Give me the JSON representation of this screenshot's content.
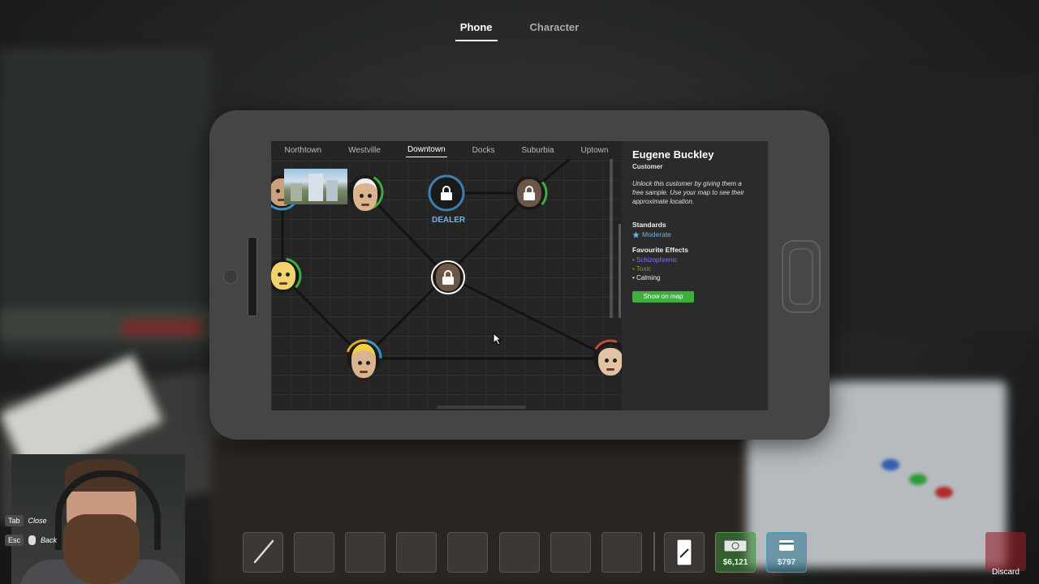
{
  "top_tabs": [
    {
      "label": "Phone",
      "active": true
    },
    {
      "label": "Character",
      "active": false
    }
  ],
  "map": {
    "regions": [
      "Northtown",
      "Westville",
      "Downtown",
      "Docks",
      "Suburbia",
      "Uptown"
    ],
    "active_region": "Downtown",
    "dealer_label": "DEALER"
  },
  "customer": {
    "name": "Eugene Buckley",
    "type": "Customer",
    "description": "Unlock this customer by giving them a free sample. Use your map to see their approximate location.",
    "standards_heading": "Standards",
    "standard_value": "Moderate",
    "effects_heading": "Favourite Effects",
    "effects": [
      {
        "name": "Schizophrenic",
        "color": "#8a6cff"
      },
      {
        "name": "Toxic",
        "color": "#7d9a3a"
      },
      {
        "name": "Calming",
        "color": "#f2f2f2"
      }
    ],
    "show_on_map_label": "Show on map"
  },
  "hotbar": {
    "cash_amount": "$6,121",
    "bank_amount": "$797",
    "discard_label": "Discard"
  },
  "key_hints": [
    {
      "key": "Tab",
      "action": "Close"
    },
    {
      "key": "Esc",
      "action": "Back"
    }
  ],
  "colors": {
    "accent_blue": "#6fb6e6",
    "button_green": "#3fae3f",
    "cash_green": "#3c8c3c",
    "bank_blue": "#32789a"
  }
}
